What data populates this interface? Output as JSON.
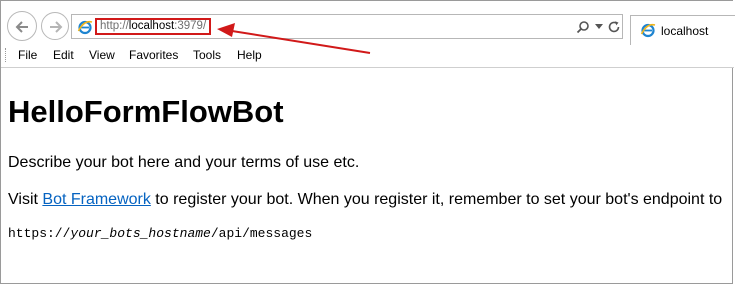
{
  "browser": {
    "address": {
      "url_prefix": "http://",
      "url_host": "localhost",
      "url_suffix": ":3979/"
    },
    "tab": {
      "title": "localhost"
    },
    "menu": [
      "File",
      "Edit",
      "View",
      "Favorites",
      "Tools",
      "Help"
    ],
    "annotation_color": "#d11919"
  },
  "page": {
    "title": "HelloFormFlowBot",
    "description": "Describe your bot here and your terms of use etc.",
    "visit_prefix": "Visit ",
    "link_text": "Bot Framework",
    "visit_suffix": " to register your bot. When you register it, remember to set your bot's endpoint to",
    "endpoint_prefix": "https://",
    "endpoint_host": "your_bots_hostname",
    "endpoint_path": "/api/messages",
    "link_color": "#0563c1"
  }
}
